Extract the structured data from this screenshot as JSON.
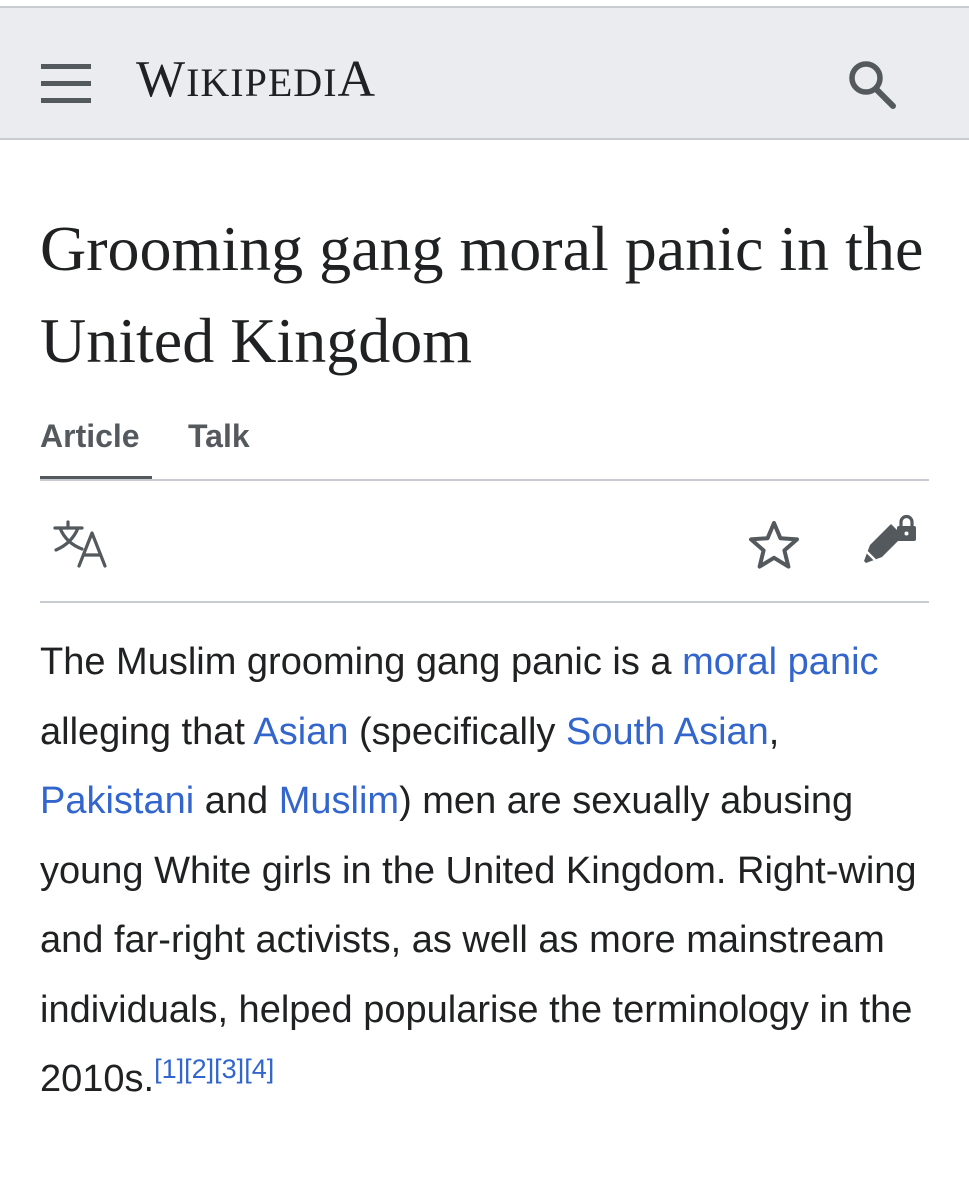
{
  "header": {
    "logo_big_first": "W",
    "logo_small_mid": "IKIPEDI",
    "logo_big_last": "A"
  },
  "article": {
    "title": "Grooming gang moral panic in the United Kingdom",
    "tabs": [
      {
        "label": "Article",
        "active": true
      },
      {
        "label": "Talk",
        "active": false
      }
    ],
    "paragraph": {
      "t1": "The Muslim grooming gang panic is a ",
      "link_moral_panic": "moral panic",
      "t2": " alleging that ",
      "link_asian": "Asian",
      "t3": " (specifically ",
      "link_south_asian": "South Asian",
      "t4": ", ",
      "link_pakistani": "Pakistani",
      "t5": " and ",
      "link_muslim": "Muslim",
      "t6": ") men are sexually abusing young White girls in the United Kingdom. Right-wing and far-right activists, as well as more mainstream individuals, helped popularise the terminology in the 2010s.",
      "refs": [
        "[1]",
        "[2]",
        "[3]",
        "[4]"
      ]
    }
  },
  "icons": {
    "menu": "hamburger-menu-icon",
    "search": "search-icon",
    "language": "language-icon",
    "watch": "star-icon",
    "edit": "edit-lock-icon"
  },
  "colors": {
    "link": "#3366cc",
    "header_bg": "#eaecf0",
    "icon": "#54595d",
    "text": "#202122"
  }
}
